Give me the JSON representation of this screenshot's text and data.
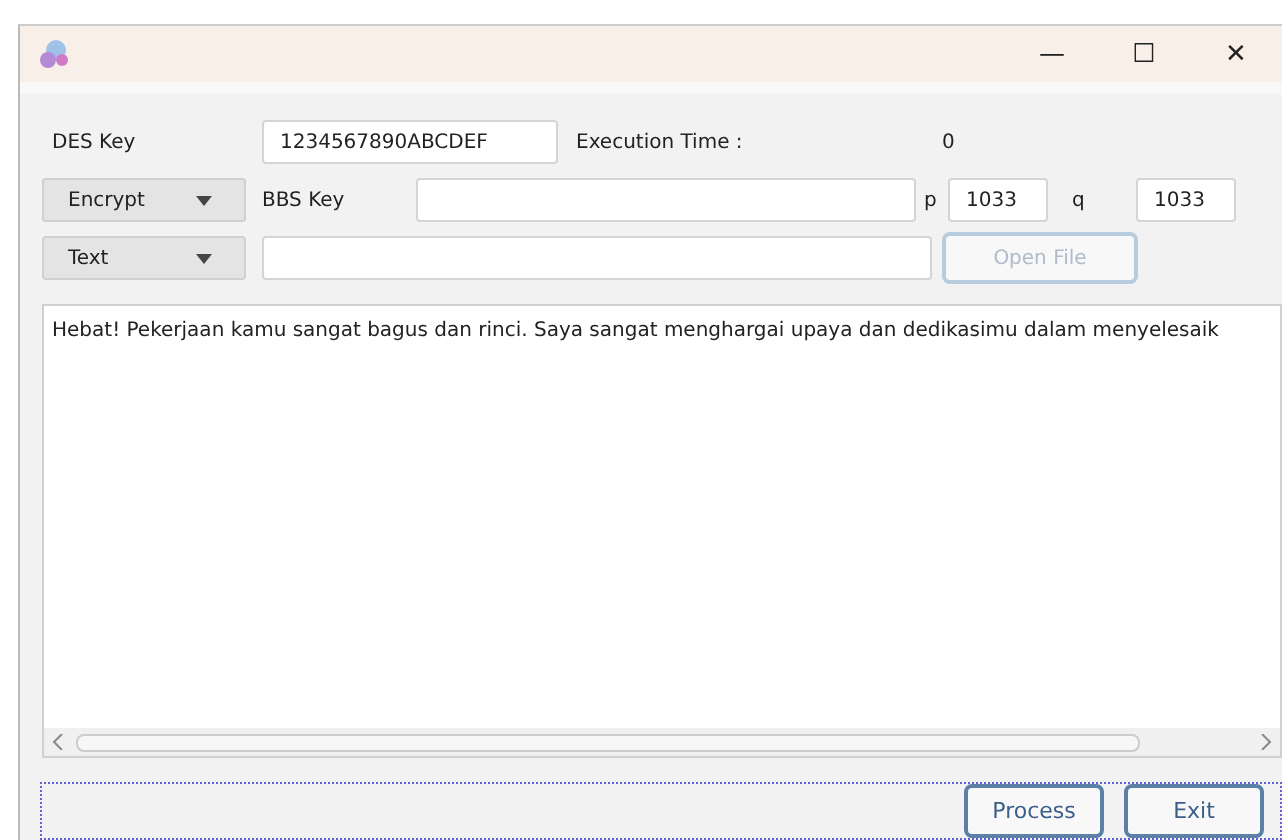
{
  "window": {
    "controls": [
      "—",
      "☐",
      "✕"
    ]
  },
  "des_key": {
    "label": "DES Key",
    "value": "1234567890ABCDEF"
  },
  "execution_time": {
    "label": "Execution Time :",
    "value": "0"
  },
  "mode_dropdown": {
    "value": "Encrypt"
  },
  "bbs_key": {
    "label": "BBS Key"
  },
  "p": {
    "label": "p",
    "value": "1033"
  },
  "q": {
    "label": "q",
    "value": "1033"
  },
  "input_type_dropdown": {
    "value": "Text"
  },
  "open_file_button": {
    "label": "Open File",
    "disabled": true
  },
  "text_area": {
    "value": "Hebat! Pekerjaan kamu sangat bagus dan rinci. Saya sangat menghargai upaya dan dedikasimu dalam menyelesaik"
  },
  "buttons": [
    "Process",
    "Exit"
  ]
}
